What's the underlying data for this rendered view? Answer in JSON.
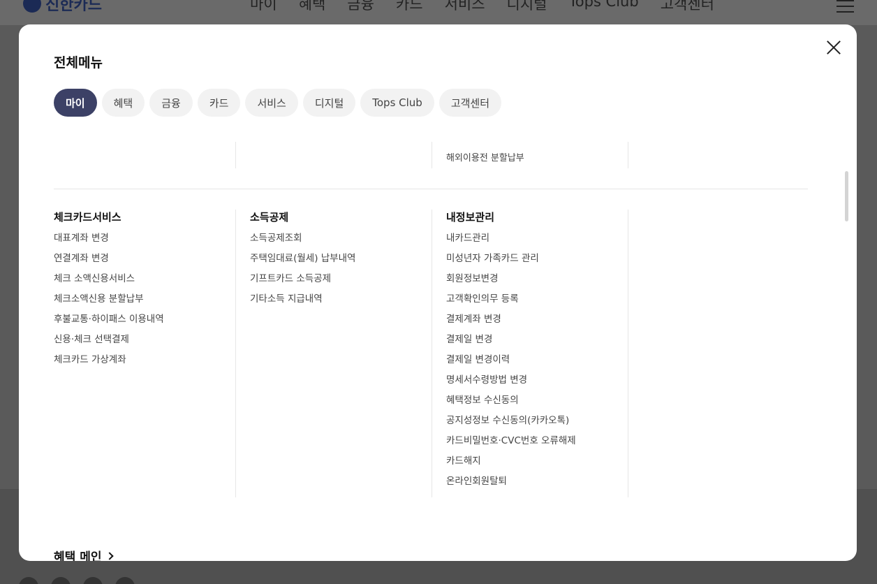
{
  "background": {
    "logo_text": "신한카드",
    "nav": [
      "마이",
      "혜택",
      "금융",
      "카드",
      "서비스",
      "디지털",
      "Tops Club",
      "고객센터"
    ]
  },
  "modal": {
    "title": "전체메뉴",
    "tabs": [
      {
        "label": "마이",
        "active": true
      },
      {
        "label": "혜택",
        "active": false
      },
      {
        "label": "금융",
        "active": false
      },
      {
        "label": "카드",
        "active": false
      },
      {
        "label": "서비스",
        "active": false
      },
      {
        "label": "디지털",
        "active": false
      },
      {
        "label": "Tops Club",
        "active": false
      },
      {
        "label": "고객센터",
        "active": false
      }
    ],
    "top_row_item": "해외이용전 분할납부",
    "columns": [
      {
        "title": "체크카드서비스",
        "items": [
          "대표계좌 변경",
          "연결계좌 변경",
          "체크 소액신용서비스",
          "체크소액신용 분할납부",
          "후불교통·하이패스 이용내역",
          "신용·체크 선택결제",
          "체크카드 가상계좌"
        ]
      },
      {
        "title": "소득공제",
        "items": [
          "소득공제조회",
          "주택임대료(월세) 납부내역",
          "기프트카드 소득공제",
          "기타소득 지급내역"
        ]
      },
      {
        "title": "내정보관리",
        "items": [
          "내카드관리",
          "미성년자 가족카드 관리",
          "회원정보변경",
          "고객확인의무 등록",
          "결제계좌 변경",
          "결제일 변경",
          "결제일 변경이력",
          "명세서수령방법 변경",
          "혜택정보 수신동의",
          "공지성정보 수신동의(카카오톡)",
          "카드비밀번호·CVC번호 오류해제",
          "카드해지",
          "온라인회원탈퇴"
        ]
      }
    ],
    "next_section_link": "혜택 메인"
  }
}
